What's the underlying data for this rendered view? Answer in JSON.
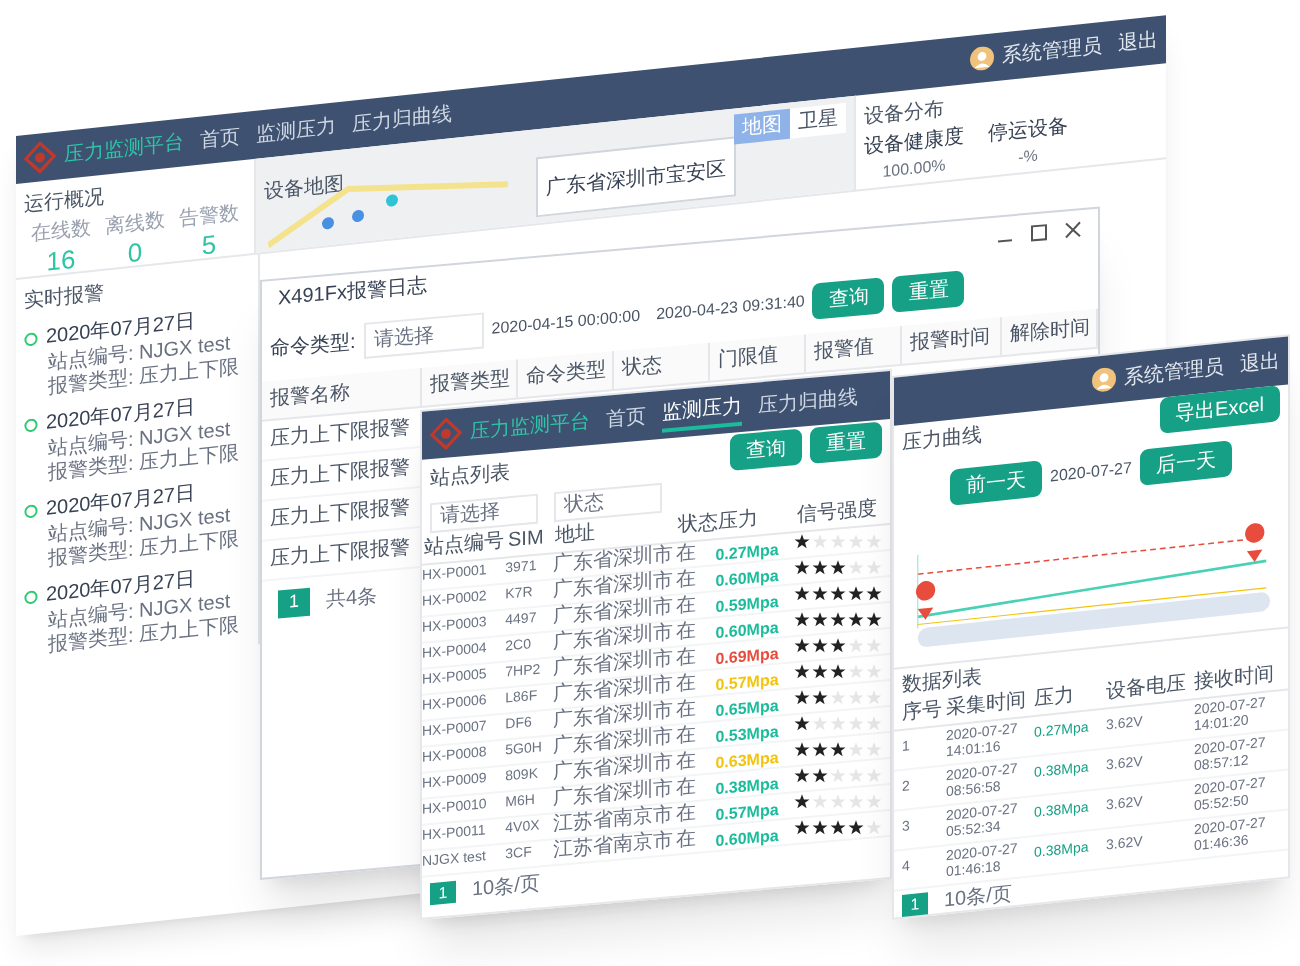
{
  "dashboard": {
    "header": {
      "logo": "压力监测平台",
      "nav": [
        {
          "label": "首页",
          "selected": false
        },
        {
          "label": "监测压力",
          "selected": false
        },
        {
          "label": "压力归曲线",
          "selected": false
        }
      ],
      "user": "系统管理员",
      "logout": "退出"
    },
    "overview": {
      "title": "运行概况",
      "stats": [
        {
          "label": "在线数",
          "value": "16"
        },
        {
          "label": "离线数",
          "value": "0"
        },
        {
          "label": "告警数",
          "value": "5"
        }
      ]
    },
    "map": {
      "title": "设备地图",
      "popup": "广东省深圳市宝安区",
      "toggle": [
        "地图",
        "卫星"
      ]
    },
    "devices": {
      "title": "设备分布",
      "items": [
        {
          "label": "设备健康度",
          "value": "100.00%"
        },
        {
          "label": "停运设备",
          "value": "-%"
        }
      ]
    },
    "alarms": {
      "title": "实时报警",
      "items": [
        {
          "time": "2020年07月27日",
          "lines": [
            "站点编号: NJGX test",
            "报警类型: 压力上下限"
          ]
        },
        {
          "time": "2020年07月27日",
          "lines": [
            "站点编号: NJGX test",
            "报警类型: 压力上下限"
          ]
        },
        {
          "time": "2020年07月27日",
          "lines": [
            "站点编号: NJGX test",
            "报警类型: 压力上下限"
          ]
        },
        {
          "time": "2020年07月27日",
          "lines": [
            "站点编号: NJGX test",
            "报警类型: 压力上下限"
          ]
        }
      ]
    }
  },
  "alarm_log": {
    "title": "X491Fx报警日志",
    "filter_label": "命令类型:",
    "filter_placeholder": "请选择",
    "start": "2020-04-15 00:00:00",
    "end": "2020-04-23 09:31:40",
    "buttons": [
      "查询",
      "重置"
    ],
    "columns": [
      "报警名称",
      "报警类型",
      "命令类型",
      "状态",
      "门限值",
      "报警值",
      "报警时间",
      "解除时间"
    ],
    "rows": [
      "压力上下限报警",
      "压力上下限报警",
      "压力上下限报警",
      "压力上下限报警"
    ],
    "pagination": {
      "page": "1",
      "total": "共4条"
    }
  },
  "stations": {
    "header": {
      "logo": "压力监测平台",
      "nav": [
        {
          "label": "首页",
          "selected": false
        },
        {
          "label": "监测压力",
          "selected": true
        },
        {
          "label": "压力归曲线",
          "selected": false
        }
      ]
    },
    "title": "站点列表",
    "filters": [
      {
        "placeholder": "请选择"
      },
      {
        "placeholder": "状态"
      }
    ],
    "buttons": [
      "查询",
      "重置"
    ],
    "columns": [
      "站点编号",
      "SIM",
      "地址",
      "状态",
      "压力",
      "信号强度"
    ],
    "rows": [
      {
        "id": "HX-P0001",
        "sim": "3971",
        "address": "广东省深圳市",
        "state": "在",
        "pressure": "0.27Mpa",
        "color": "#1abc9c",
        "stars": 1
      },
      {
        "id": "HX-P0002",
        "sim": "K7R",
        "address": "广东省深圳市",
        "state": "在",
        "pressure": "0.60Mpa",
        "color": "#1abc9c",
        "stars": 3
      },
      {
        "id": "HX-P0003",
        "sim": "4497",
        "address": "广东省深圳市",
        "state": "在",
        "pressure": "0.59Mpa",
        "color": "#1abc9c",
        "stars": 5
      },
      {
        "id": "HX-P0004",
        "sim": "2C0",
        "address": "广东省深圳市",
        "state": "在",
        "pressure": "0.60Mpa",
        "color": "#1abc9c",
        "stars": 5
      },
      {
        "id": "HX-P0005",
        "sim": "7HP2",
        "address": "广东省深圳市",
        "state": "在",
        "pressure": "0.69Mpa",
        "color": "#e74c3c",
        "stars": 3
      },
      {
        "id": "HX-P0006",
        "sim": "L86F",
        "address": "广东省深圳市",
        "state": "在",
        "pressure": "0.57Mpa",
        "color": "#f1c40f",
        "stars": 3
      },
      {
        "id": "HX-P0007",
        "sim": "DF6",
        "address": "广东省深圳市",
        "state": "在",
        "pressure": "0.65Mpa",
        "color": "#1abc9c",
        "stars": 2
      },
      {
        "id": "HX-P0008",
        "sim": "5G0H",
        "address": "广东省深圳市",
        "state": "在",
        "pressure": "0.53Mpa",
        "color": "#1abc9c",
        "stars": 1
      },
      {
        "id": "HX-P0009",
        "sim": "809K",
        "address": "广东省深圳市",
        "state": "在",
        "pressure": "0.63Mpa",
        "color": "#f1c40f",
        "stars": 3
      },
      {
        "id": "HX-P0010",
        "sim": "M6H",
        "address": "广东省深圳市",
        "state": "在",
        "pressure": "0.38Mpa",
        "color": "#1abc9c",
        "stars": 2
      },
      {
        "id": "HX-P0011",
        "sim": "4V0X",
        "address": "江苏省南京市",
        "state": "在",
        "pressure": "0.57Mpa",
        "color": "#1abc9c",
        "stars": 1
      },
      {
        "id": "NJGX test",
        "sim": "3CF",
        "address": "江苏省南京市",
        "state": "在",
        "pressure": "0.60Mpa",
        "color": "#1abc9c",
        "stars": 4
      }
    ],
    "pagination": {
      "page": "1",
      "size": "10条/页"
    }
  },
  "curve": {
    "header": {
      "user": "系统管理员",
      "logout": "退出"
    },
    "title": "压力曲线",
    "export": "导出Excel",
    "prev": "前一天",
    "date": "2020-07-27",
    "next": "后一天",
    "list_title": "数据列表",
    "columns": [
      "序号",
      "采集时间",
      "压力",
      "设备电压",
      "接收时间"
    ],
    "rows": [
      {
        "no": "1",
        "time": "2020-07-27 14:01:16",
        "pressure": "0.27Mpa",
        "voltage": "3.62V",
        "received": "2020-07-27 14:01:20"
      },
      {
        "no": "2",
        "time": "2020-07-27 08:56:58",
        "pressure": "0.38Mpa",
        "voltage": "3.62V",
        "received": "2020-07-27 08:57:12"
      },
      {
        "no": "3",
        "time": "2020-07-27 05:52:34",
        "pressure": "0.38Mpa",
        "voltage": "3.62V",
        "received": "2020-07-27 05:52:50"
      },
      {
        "no": "4",
        "time": "2020-07-27 01:46:18",
        "pressure": "0.38Mpa",
        "voltage": "3.62V",
        "received": "2020-07-27 01:46:36"
      }
    ],
    "pagination": {
      "page": "1",
      "size": "10条/页"
    }
  }
}
